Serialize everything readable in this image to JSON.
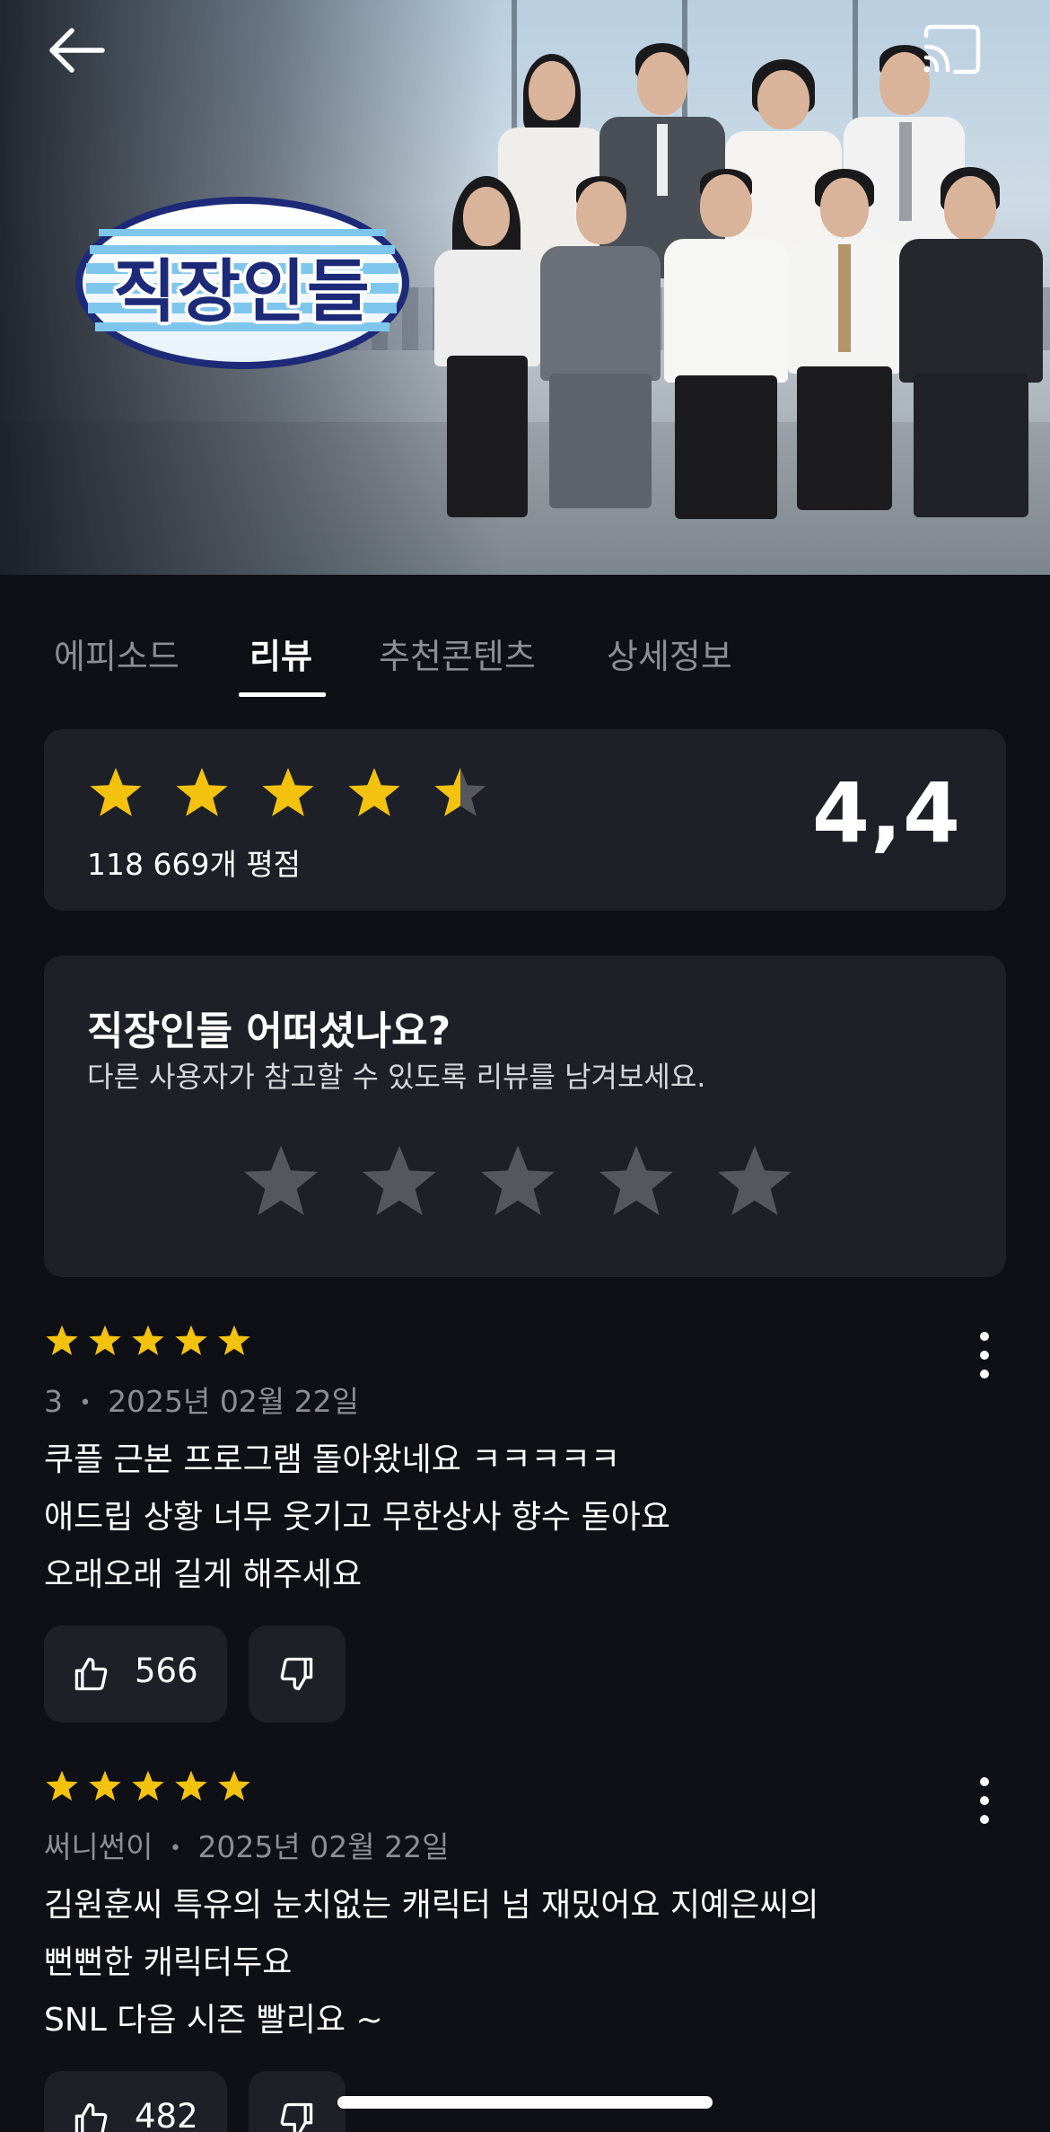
{
  "hero": {
    "title_logo": "직장인들",
    "back_icon": "arrow-left-icon",
    "cast_icon": "cast-icon"
  },
  "tabs": [
    {
      "label": "에피소드",
      "active": false
    },
    {
      "label": "리뷰",
      "active": true
    },
    {
      "label": "추천콘텐츠",
      "active": false
    },
    {
      "label": "상세정보",
      "active": false
    }
  ],
  "rating": {
    "stars": 4.5,
    "count_label": "118 669개 평점",
    "score": "4,4",
    "star_color": "#f2c20f"
  },
  "ask": {
    "title": "직장인들 어떠셨나요?",
    "subtitle": "다른 사용자가 참고할 수 있도록 리뷰를 남겨보세요.",
    "star_count": 5,
    "empty_star_color": "#55575c"
  },
  "reviews": [
    {
      "stars": 5,
      "author": "3",
      "separator": "•",
      "date": "2025년 02월 22일",
      "lines": [
        "쿠플 근본 프로그램 돌아왔네요 ㅋㅋㅋㅋㅋ",
        "애드립 상황 너무 웃기고 무한상사 향수 돋아요",
        "오래오래 길게 해주세요"
      ],
      "likes": "566"
    },
    {
      "stars": 5,
      "author": "써니썬이",
      "separator": "•",
      "date": "2025년 02월 22일",
      "lines": [
        "김원훈씨 특유의 눈치없는 캐릭터 넘 재밌어요 지예은씨의",
        "뻔뻔한 캐릭터두요",
        "SNL 다음 시즌  빨리요 ~"
      ],
      "likes": "482"
    }
  ],
  "colors": {
    "background": "#0e1015",
    "card": "#1d2026",
    "muted_text": "#8b8e95",
    "accent_star": "#f2c20f"
  }
}
